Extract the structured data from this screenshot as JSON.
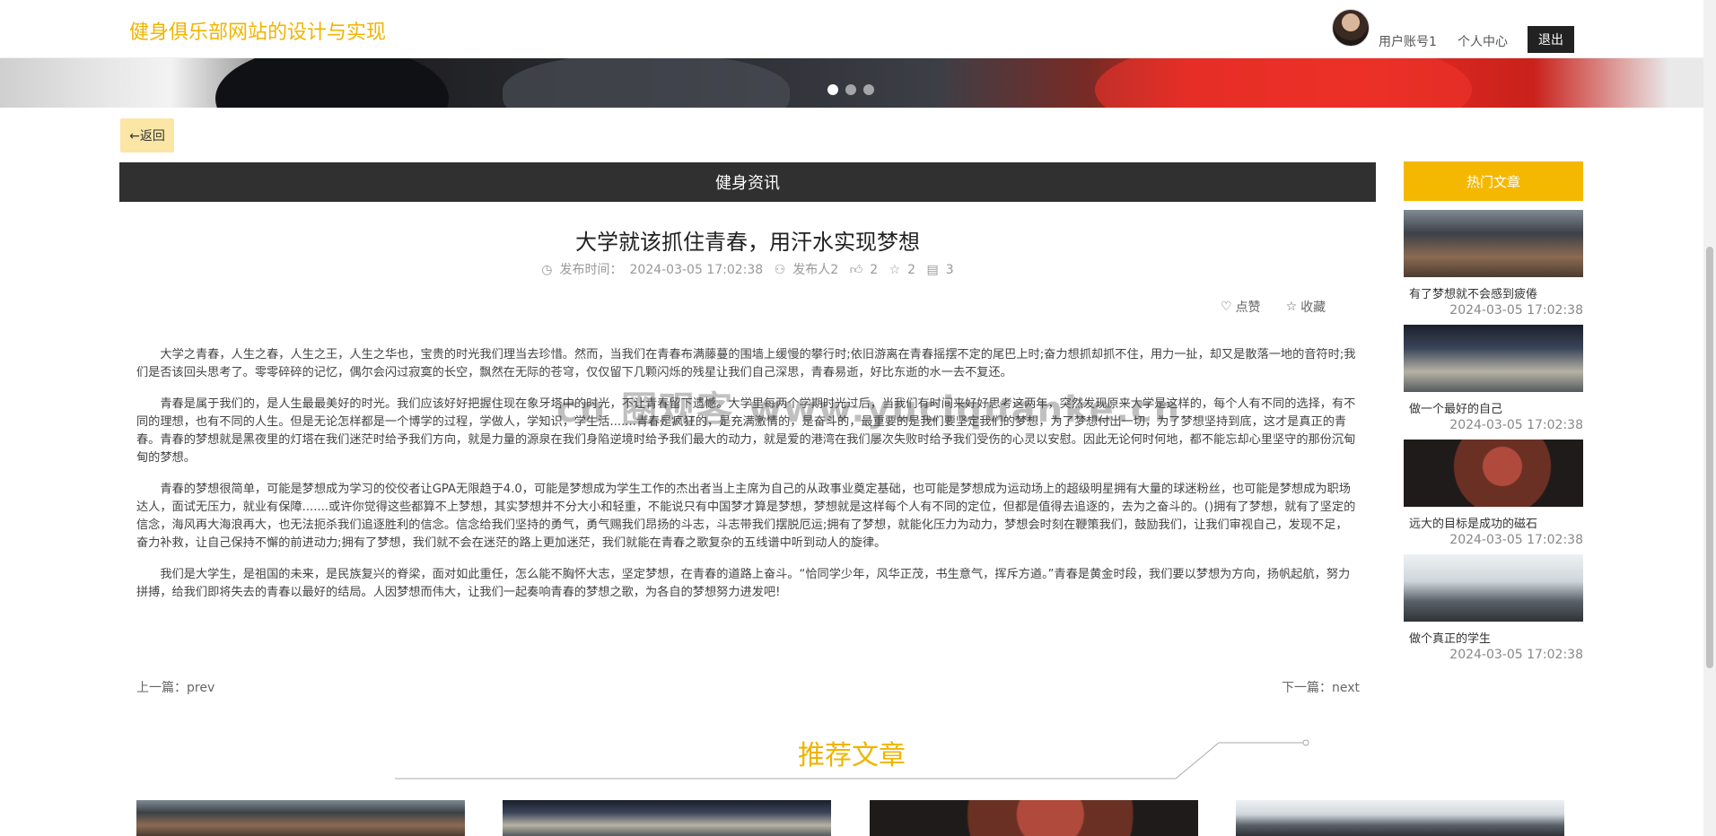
{
  "header": {
    "site_title": "健身俱乐部网站的设计与实现",
    "user_account": "用户账号1",
    "personal_center": "个人中心",
    "logout": "退出"
  },
  "back_button": "←返回",
  "section_title": "健身资讯",
  "article": {
    "title": "大学就该抓住青春，用汗水实现梦想",
    "publish_label": "发布时间：",
    "publish_time": "2024-03-05 17:02:38",
    "publisher": "发布人2",
    "likes": "2",
    "favorites": "2",
    "comments": "3",
    "like_action": "点赞",
    "favorite_action": "收藏",
    "paragraphs": [
      "大学之青春，人生之春，人生之王，人生之华也，宝贵的时光我们理当去珍惜。然而，当我们在青春布满藤蔓的围墙上缓慢的攀行时;依旧游离在青春摇摆不定的尾巴上时;奋力想抓却抓不住，用力一扯，却又是散落一地的音符时;我们是否该回头思考了。零零碎碎的记忆，偶尔会闪过寂寞的长空，飘然在无际的苍穹，仅仅留下几颗闪烁的残星让我们自己深思，青春易逝，好比东逝的水一去不复还。",
      "青春是属于我们的，是人生最最美好的时光。我们应该好好把握住现在象牙塔中的时光，不让青春留下遗憾。大学里每两个学期时光过后，当我们有时间来好好思考这两年，突然发现原来大学是这样的，每个人有不同的选择，有不同的理想，也有不同的人生。但是无论怎样都是一个博学的过程，学做人，学知识，学生活.......青春是疯狂的，是充满激情的，是奋斗的，最重要的是我们要坚定我们的梦想，为了梦想付出一切，为了梦想坚持到底，这才是真正的青春。青春的梦想就是黑夜里的灯塔在我们迷茫时给予我们方向，就是力量的源泉在我们身陷逆境时给予我们最大的动力，就是爱的港湾在我们屡次失败时给予我们受伤的心灵以安慰。因此无论何时何地，都不能忘却心里坚守的那份沉甸甸的梦想。",
      "青春的梦想很简单，可能是梦想成为学习的佼佼者让GPA无限趋于4.0，可能是梦想成为学生工作的杰出者当上主席为自己的从政事业奠定基础，也可能是梦想成为运动场上的超级明星拥有大量的球迷粉丝，也可能是梦想成为职场达人，面试无压力，就业有保障.......或许你觉得这些都算不上梦想，其实梦想并不分大小和轻重，不能说只有中国梦才算是梦想，梦想就是这样每个人有不同的定位，但都是值得去追逐的，去为之奋斗的。()拥有了梦想，就有了坚定的信念，海风再大海浪再大，也无法扼杀我们追逐胜利的信念。信念给我们坚持的勇气，勇气赐我们昂扬的斗志，斗志带我们摆脱厄运;拥有了梦想，就能化压力为动力，梦想会时刻在鞭策我们，鼓励我们，让我们审视自己，发现不足，奋力补救，让自己保持不懈的前进动力;拥有了梦想，我们就不会在迷茫的路上更加迷茫，我们就能在青春之歌复杂的五线谱中听到动人的旋律。",
      "我们是大学生，是祖国的未来，是民族复兴的脊梁，面对如此重任，怎么能不胸怀大志，坚定梦想，在青春的道路上奋斗。“恰同学少年，风华正茂，书生意气，挥斥方遒。”青春是黄金时段，我们要以梦想为方向，扬帆起航，努力拼搏，给我们即将失去的青春以最好的结局。人因梦想而伟大，让我们一起奏响青春的梦想之歌，为各自的梦想努力进发吧!"
    ],
    "prev_label": "上一篇：",
    "prev_value": "prev",
    "next_label": "下一篇：",
    "next_value": "next"
  },
  "sidebar": {
    "title": "热门文章",
    "items": [
      {
        "title": "有了梦想就不会感到疲倦",
        "time": "2024-03-05 17:02:38"
      },
      {
        "title": "做一个最好的自己",
        "time": "2024-03-05 17:02:38"
      },
      {
        "title": "远大的目标是成功的磁石",
        "time": "2024-03-05 17:02:38"
      },
      {
        "title": "做个真正的学生",
        "time": "2024-03-05 17:02:38"
      }
    ]
  },
  "recommended_title": "推荐文章",
  "watermark": "cn 圈观客 www.yuciquanke.cn",
  "colors": {
    "accent": "#f0b400",
    "dark_bar": "#303030",
    "back_button_bg": "#fbe6a6"
  }
}
